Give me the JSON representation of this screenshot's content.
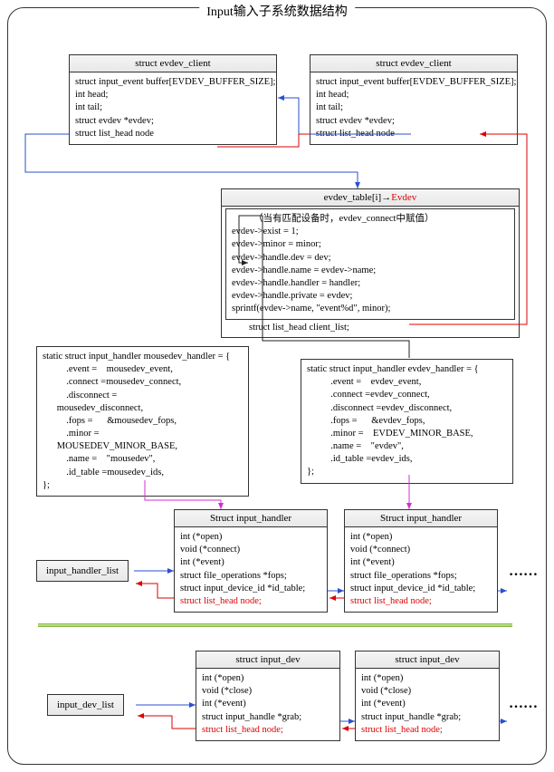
{
  "title": "Input输入子系统数据结构",
  "clients": {
    "header": "struct evdev_client",
    "body": "struct input_event buffer[EVDEV_BUFFER_SIZE];\nint head;\nint tail;\nstruct evdev *evdev;\nstruct list_head node"
  },
  "evdev_box": {
    "header_prefix": "evdev_table[i]→",
    "header_red": "Evdev",
    "note": "（当有匹配设备时，evdev_connect中赋值）",
    "assigns": "evdev->exist = 1;\nevdev->minor = minor;\nevdev->handle.dev = dev;\nevdev->handle.name = evdev->name;\nevdev->handle.handler = handler;\nevdev->handle.private = evdev;\nsprintf(evdev->name, \"event%d\", minor);",
    "client_list": "struct list_head client_list;"
  },
  "mousedev_handler": "static struct input_handler mousedev_handler = {\n          .event =    mousedev_event,\n          .connect =mousedev_connect,\n          .disconnect =\n      mousedev_disconnect,\n          .fops =      &mousedev_fops,\n          .minor =\n      MOUSEDEV_MINOR_BASE,\n          .name =    \"mousedev\",\n          .id_table =mousedev_ids,\n};",
  "evdev_handler": "static struct input_handler evdev_handler = {\n          .event =    evdev_event,\n          .connect =evdev_connect,\n          .disconnect =evdev_disconnect,\n          .fops =      &evdev_fops,\n          .minor =    EVDEV_MINOR_BASE,\n          .name =    \"evdev\",\n          .id_table =evdev_ids,\n};",
  "input_handler": {
    "header": "Struct input_handler",
    "body": "int (*open)\nvoid (*connect)\nint (*event)\nstruct file_operations *fops;\nstruct input_device_id *id_table;",
    "red": "struct list_head node;"
  },
  "input_dev": {
    "header": "struct input_dev",
    "body": "int (*open)\nvoid (*close)\nint (*event)\nstruct input_handle *grab;",
    "red": "struct list_head node;"
  },
  "labels": {
    "handler_list": "input_handler_list",
    "dev_list": "input_dev_list"
  },
  "dots": "……"
}
